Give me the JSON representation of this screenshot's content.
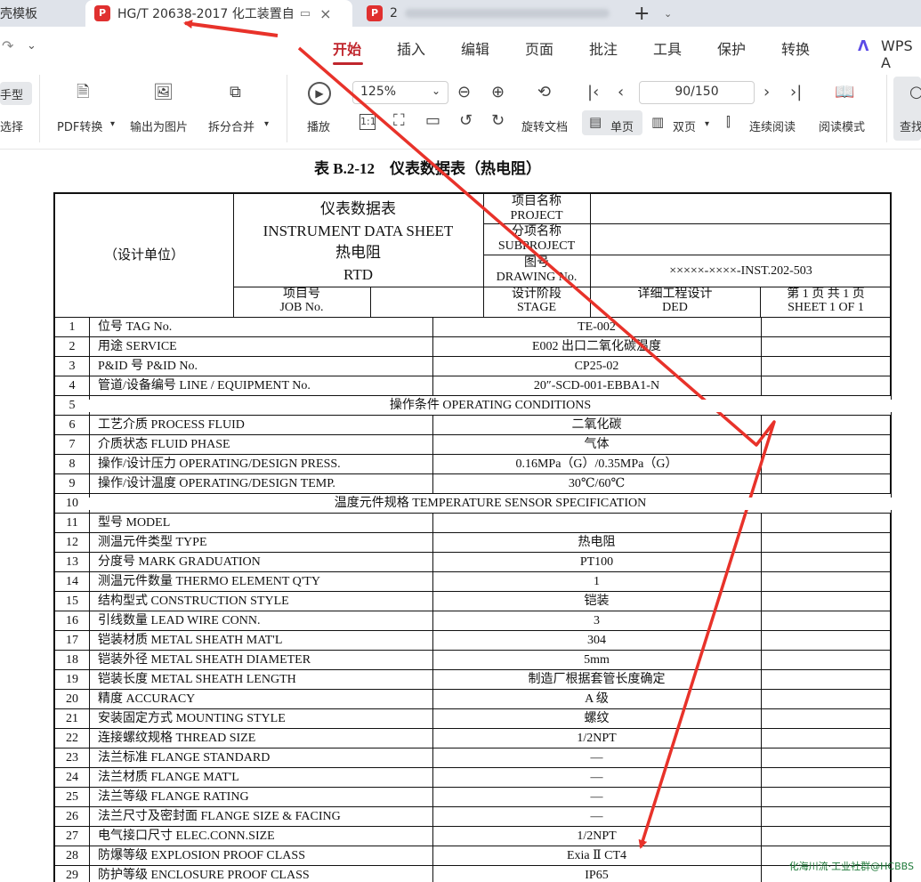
{
  "tabs": {
    "left_partial": "壳模板",
    "active": "HG/T 20638-2017 化工装置自",
    "pdf_badge": "P",
    "third_partial": "2",
    "close_icon": "×",
    "new_tab": "+"
  },
  "menu": {
    "items": [
      "开始",
      "插入",
      "编辑",
      "页面",
      "批注",
      "工具",
      "保护",
      "转换"
    ],
    "wps": "WPS A"
  },
  "toolbar": {
    "hand": "手型",
    "select": "选择",
    "pdf_convert": "PDF转换",
    "export_img": "输出为图片",
    "split_merge": "拆分合并",
    "play": "播放",
    "zoom": "125%",
    "page_input": "90/150",
    "rotate": "旋转文档",
    "single": "单页",
    "double": "双页",
    "continuous": "连续阅读",
    "read_mode": "阅读模式",
    "find": "查找"
  },
  "document": {
    "title": "表 B.2-12　仪表数据表（热电阻）",
    "design_unit": "（设计单位）",
    "sheet_title_cn": "仪表数据表",
    "sheet_title_en": "INSTRUMENT DATA SHEET",
    "sheet_type_cn": "热电阻",
    "sheet_type_en": "RTD",
    "project_cn": "项目名称",
    "project_en": "PROJECT",
    "subproject_cn": "分项名称",
    "subproject_en": "SUBPROJECT",
    "drawing_cn": "图号",
    "drawing_en": "DRAWING No.",
    "drawing_no": "×××××-××××-INST.202-503",
    "job_cn": "项目号",
    "job_en": "JOB No.",
    "stage_cn": "设计阶段",
    "stage_en": "STAGE",
    "ded_cn": "详细工程设计",
    "ded_en": "DED",
    "sheet_cn": "第 1 页 共 1 页",
    "sheet_en": "SHEET 1 OF 1",
    "rows": [
      {
        "no": "1",
        "label": "位号  TAG No.",
        "value": "TE-002"
      },
      {
        "no": "2",
        "label": "用途  SERVICE",
        "value": "E002 出口二氧化碳温度"
      },
      {
        "no": "3",
        "label": "P&ID 号  P&ID No.",
        "value": "CP25-02"
      },
      {
        "no": "4",
        "label": "管道/设备编号  LINE / EQUIPMENT No.",
        "value": "20″-SCD-001-EBBA1-N"
      },
      {
        "no": "5",
        "section": "操作条件  OPERATING CONDITIONS"
      },
      {
        "no": "6",
        "label": "工艺介质  PROCESS FLUID",
        "value": "二氧化碳"
      },
      {
        "no": "7",
        "label": "介质状态  FLUID PHASE",
        "value": "气体"
      },
      {
        "no": "8",
        "label": "操作/设计压力  OPERATING/DESIGN PRESS.",
        "value": "0.16MPa（G）/0.35MPa（G）"
      },
      {
        "no": "9",
        "label": "操作/设计温度  OPERATING/DESIGN TEMP.",
        "value": "30℃/60℃"
      },
      {
        "no": "10",
        "section": "温度元件规格  TEMPERATURE SENSOR SPECIFICATION"
      },
      {
        "no": "11",
        "label": "型号  MODEL",
        "value": ""
      },
      {
        "no": "12",
        "label": "测温元件类型  TYPE",
        "value": "热电阻"
      },
      {
        "no": "13",
        "label": "分度号  MARK GRADUATION",
        "value": "PT100"
      },
      {
        "no": "14",
        "label": "测温元件数量  THERMO ELEMENT Q'TY",
        "value": "1"
      },
      {
        "no": "15",
        "label": "结构型式  CONSTRUCTION STYLE",
        "value": "铠装"
      },
      {
        "no": "16",
        "label": "引线数量  LEAD WIRE CONN.",
        "value": "3"
      },
      {
        "no": "17",
        "label": "铠装材质  METAL SHEATH MAT'L",
        "value": "304"
      },
      {
        "no": "18",
        "label": "铠装外径  METAL SHEATH DIAMETER",
        "value": "5mm"
      },
      {
        "no": "19",
        "label": "铠装长度  METAL SHEATH LENGTH",
        "value": "制造厂根据套管长度确定"
      },
      {
        "no": "20",
        "label": "精度  ACCURACY",
        "value": "A 级"
      },
      {
        "no": "21",
        "label": "安装固定方式  MOUNTING STYLE",
        "value": "螺纹"
      },
      {
        "no": "22",
        "label": "连接螺纹规格  THREAD SIZE",
        "value": "1/2NPT"
      },
      {
        "no": "23",
        "label": "法兰标准  FLANGE STANDARD",
        "value": "—"
      },
      {
        "no": "24",
        "label": "法兰材质  FLANGE MAT'L",
        "value": "—"
      },
      {
        "no": "25",
        "label": "法兰等级  FLANGE RATING",
        "value": "—"
      },
      {
        "no": "26",
        "label": "法兰尺寸及密封面  FLANGE SIZE & FACING",
        "value": "—"
      },
      {
        "no": "27",
        "label": "电气接口尺寸  ELEC.CONN.SIZE",
        "value": "1/2NPT"
      },
      {
        "no": "28",
        "label": "防爆等级  EXPLOSION PROOF CLASS",
        "value": "Exia Ⅱ CT4"
      },
      {
        "no": "29",
        "label": "防护等级  ENCLOSURE PROOF CLASS",
        "value": "IP65"
      }
    ]
  },
  "watermark": "化海川流·工业社群@HCBBS",
  "colors": {
    "accent": "#c0262d",
    "annotation_arrow": "#e8322a",
    "pdf_badge": "#e0302f"
  }
}
